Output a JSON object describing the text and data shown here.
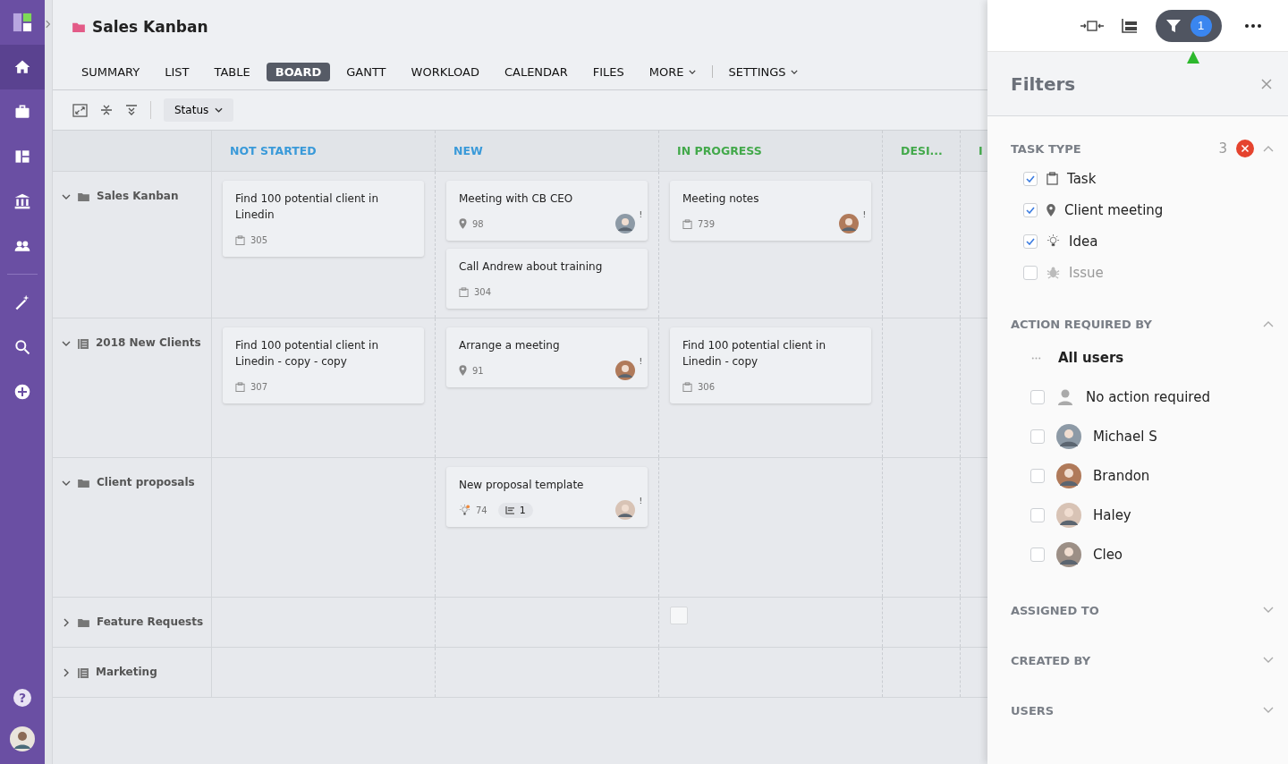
{
  "nav": {
    "items": [
      {
        "kind": "home",
        "selected": true
      },
      {
        "kind": "briefcase",
        "selected": false
      },
      {
        "kind": "dashboard",
        "selected": false
      },
      {
        "kind": "bank",
        "selected": false
      },
      {
        "kind": "users",
        "selected": false
      },
      {
        "kind": "wand",
        "selected": false
      },
      {
        "kind": "search",
        "selected": false
      },
      {
        "kind": "plus",
        "selected": false
      }
    ],
    "help": "?"
  },
  "project": {
    "title": "Sales Kanban"
  },
  "tabs": [
    {
      "label": "SUMMARY",
      "selected": false
    },
    {
      "label": "LIST",
      "selected": false
    },
    {
      "label": "TABLE",
      "selected": false
    },
    {
      "label": "BOARD",
      "selected": true
    },
    {
      "label": "GANTT",
      "selected": false
    },
    {
      "label": "WORKLOAD",
      "selected": false
    },
    {
      "label": "CALENDAR",
      "selected": false
    },
    {
      "label": "FILES",
      "selected": false
    },
    {
      "label": "MORE",
      "selected": false,
      "kind": "dropdown"
    },
    {
      "label": "SETTINGS",
      "selected": false,
      "kind": "dropdown"
    }
  ],
  "toolbar": {
    "group_by": "Status"
  },
  "columns": [
    {
      "title": "NOT STARTED",
      "color": "#3a9ad9"
    },
    {
      "title": "NEW",
      "color": "#3a9ad9"
    },
    {
      "title": "IN PROGRESS",
      "color": "#43a94b"
    },
    {
      "title": "DESI...",
      "color": "#43a94b"
    },
    {
      "title": "I",
      "color": "#43a94b"
    }
  ],
  "lanes": [
    {
      "name": "Sales Kanban",
      "kind": "folder",
      "expanded": true,
      "cells": [
        [
          {
            "title": "Find 100 potential client in Linedin",
            "kind": "task",
            "number": "305"
          }
        ],
        [
          {
            "title": "Meeting with CB CEO",
            "kind": "meeting",
            "number": "98",
            "assignee": true,
            "alert": "!"
          },
          {
            "title": "Call Andrew about training",
            "kind": "task",
            "number": "304"
          }
        ],
        [
          {
            "title": "Meeting notes",
            "kind": "task",
            "number": "739",
            "assignee": true,
            "alert": "!"
          }
        ],
        [],
        []
      ]
    },
    {
      "name": "2018 New Clients",
      "kind": "list",
      "expanded": true,
      "cells": [
        [
          {
            "title": "Find 100 potential client in Linedin - copy - copy",
            "kind": "task",
            "number": "307"
          }
        ],
        [
          {
            "title": "Arrange a meeting",
            "kind": "meeting",
            "number": "91",
            "assignee": true,
            "alert": "!"
          }
        ],
        [
          {
            "title": "Find 100 potential client in Linedin - copy",
            "kind": "task",
            "number": "306"
          }
        ],
        [],
        []
      ]
    },
    {
      "name": "Client proposals",
      "kind": "folder",
      "expanded": true,
      "cells": [
        [],
        [
          {
            "title": "New proposal template",
            "kind": "idea",
            "number": "74",
            "subtasks": "1",
            "assignee": true,
            "alert": "!"
          }
        ],
        [],
        [],
        []
      ]
    },
    {
      "name": "Feature Requests",
      "kind": "folder",
      "expanded": false,
      "cells": [
        [],
        [],
        [
          {
            "kind": "placeholder"
          }
        ],
        [],
        []
      ]
    },
    {
      "name": "Marketing",
      "kind": "list",
      "expanded": false
    }
  ],
  "filters": {
    "active_count": "1",
    "title": "Filters",
    "sections": [
      {
        "title": "TASK TYPE",
        "expanded": true,
        "count": "3",
        "kind": "types",
        "items": [
          {
            "label": "Task",
            "kind": "task",
            "checked": true
          },
          {
            "label": "Client meeting",
            "kind": "meeting",
            "checked": true
          },
          {
            "label": "Idea",
            "kind": "idea",
            "checked": true
          },
          {
            "label": "Issue",
            "kind": "bug",
            "checked": false
          }
        ]
      },
      {
        "title": "ACTION REQUIRED BY",
        "expanded": true,
        "kind": "users",
        "all_label": "All users",
        "items": [
          {
            "label": "No action required",
            "kind": "none",
            "checked": false
          },
          {
            "label": "Michael S",
            "kind": "user",
            "checked": false
          },
          {
            "label": "Brandon",
            "kind": "user",
            "checked": false
          },
          {
            "label": "Haley",
            "kind": "user",
            "checked": false
          },
          {
            "label": "Cleo",
            "kind": "user",
            "checked": false
          }
        ]
      },
      {
        "title": "ASSIGNED TO",
        "expanded": false
      },
      {
        "title": "CREATED BY",
        "expanded": false
      },
      {
        "title": "USERS",
        "expanded": false
      }
    ]
  }
}
